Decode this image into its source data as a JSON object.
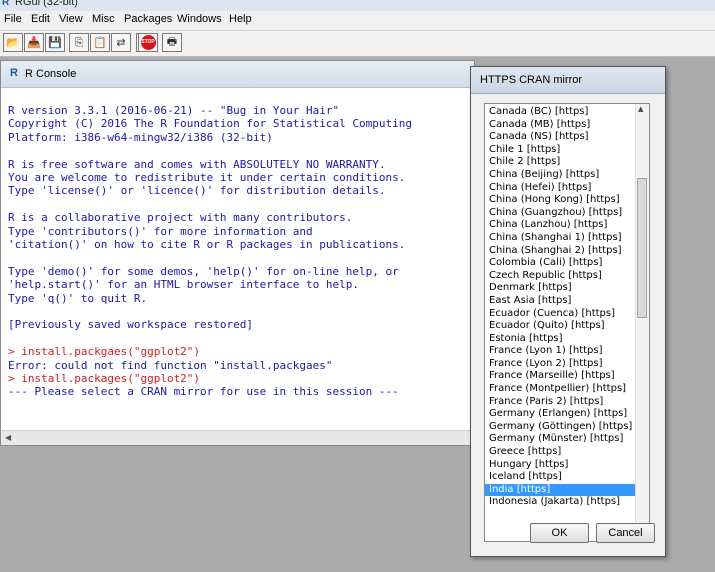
{
  "window": {
    "title": "RGui (32-bit)",
    "app_icon": "R"
  },
  "menu": [
    "File",
    "Edit",
    "View",
    "Misc",
    "Packages",
    "Windows",
    "Help"
  ],
  "toolbar": {
    "buttons": [
      {
        "name": "open-script-icon",
        "glyph": "📂"
      },
      {
        "name": "load-workspace-icon",
        "glyph": "📥"
      },
      {
        "name": "save-workspace-icon",
        "glyph": "💾"
      },
      {
        "name": "copy-icon",
        "glyph": "⎘"
      },
      {
        "name": "paste-icon",
        "glyph": "📋"
      },
      {
        "name": "copy-paste-icon",
        "glyph": "⇄"
      },
      {
        "name": "refresh-icon",
        "glyph": "↻"
      }
    ],
    "stop_label": "STOP",
    "print_glyph": "🖶"
  },
  "console": {
    "title": "R Console",
    "icon": "R",
    "lines": [
      {
        "text": "R version 3.3.1 (2016-06-21) -- \"Bug in Your Hair\"",
        "color": "blue"
      },
      {
        "text": "Copyright (C) 2016 The R Foundation for Statistical Computing",
        "color": "blue"
      },
      {
        "text": "Platform: i386-w64-mingw32/i386 (32-bit)",
        "color": "blue"
      },
      {
        "text": "",
        "color": "blue"
      },
      {
        "text": "R is free software and comes with ABSOLUTELY NO WARRANTY.",
        "color": "blue"
      },
      {
        "text": "You are welcome to redistribute it under certain conditions.",
        "color": "blue"
      },
      {
        "text": "Type 'license()' or 'licence()' for distribution details.",
        "color": "blue"
      },
      {
        "text": "",
        "color": "blue"
      },
      {
        "text": "R is a collaborative project with many contributors.",
        "color": "blue"
      },
      {
        "text": "Type 'contributors()' for more information and",
        "color": "blue"
      },
      {
        "text": "'citation()' on how to cite R or R packages in publications.",
        "color": "blue"
      },
      {
        "text": "",
        "color": "blue"
      },
      {
        "text": "Type 'demo()' for some demos, 'help()' for on-line help, or",
        "color": "blue"
      },
      {
        "text": "'help.start()' for an HTML browser interface to help.",
        "color": "blue"
      },
      {
        "text": "Type 'q()' to quit R.",
        "color": "blue"
      },
      {
        "text": "",
        "color": "blue"
      },
      {
        "text": "[Previously saved workspace restored]",
        "color": "blue"
      },
      {
        "text": "",
        "color": "blue"
      },
      {
        "text": "> install.packgaes(\"ggplot2\")",
        "color": "red"
      },
      {
        "text": "Error: could not find function \"install.packgaes\"",
        "color": "blue"
      },
      {
        "text": "> install.packages(\"ggplot2\")",
        "color": "red"
      },
      {
        "text": "--- Please select a CRAN mirror for use in this session ---",
        "color": "blue"
      }
    ]
  },
  "dialog": {
    "title": "HTTPS CRAN mirror",
    "items": [
      "Canada (BC) [https]",
      "Canada (MB) [https]",
      "Canada (NS) [https]",
      "Chile 1 [https]",
      "Chile 2 [https]",
      "China (Beijing) [https]",
      "China (Hefei) [https]",
      "China (Hong Kong) [https]",
      "China (Guangzhou) [https]",
      "China (Lanzhou) [https]",
      "China (Shanghai 1) [https]",
      "China (Shanghai 2) [https]",
      "Colombia (Cali) [https]",
      "Czech Republic [https]",
      "Denmark [https]",
      "East Asia [https]",
      "Ecuador (Cuenca) [https]",
      "Ecuador (Quito) [https]",
      "Estonia [https]",
      "France (Lyon 1) [https]",
      "France (Lyon 2) [https]",
      "France (Marseille) [https]",
      "France (Montpellier) [https]",
      "France (Paris 2) [https]",
      "Germany (Erlangen) [https]",
      "Germany (Göttingen) [https]",
      "Germany (Münster) [https]",
      "Greece [https]",
      "Hungary [https]",
      "Iceland [https]",
      "India [https]",
      "Indonesia (Jakarta) [https]"
    ],
    "selected_index": 30,
    "ok_label": "OK",
    "cancel_label": "Cancel"
  },
  "colors": {
    "console_text": "#1a1aa8",
    "console_input": "#cf1f1f",
    "selection": "#3399ff"
  }
}
